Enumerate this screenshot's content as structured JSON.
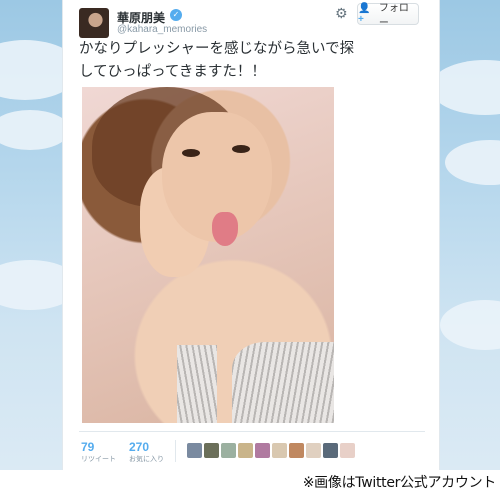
{
  "tweet": {
    "display_name": "華原朋美",
    "handle": "@kahara_memories",
    "follow_label": "フォロー",
    "text_line1": "かなりプレッシャーを感じながら急いで探",
    "text_line2": "してひっぱってきますた！！",
    "retweets": {
      "count": "79",
      "label": "リツイート"
    },
    "favorites": {
      "count": "270",
      "label": "お気に入り"
    },
    "favoriter_avatars": 10
  },
  "caption": "※画像はTwitter公式アカウント",
  "colors": {
    "link_blue": "#55acee",
    "text": "#292f33",
    "muted": "#8899a6",
    "background_sky": "#b4d6ec"
  },
  "icons": {
    "gear": "gear-icon",
    "follow": "person-plus-icon",
    "verified": "verified-badge-icon"
  }
}
